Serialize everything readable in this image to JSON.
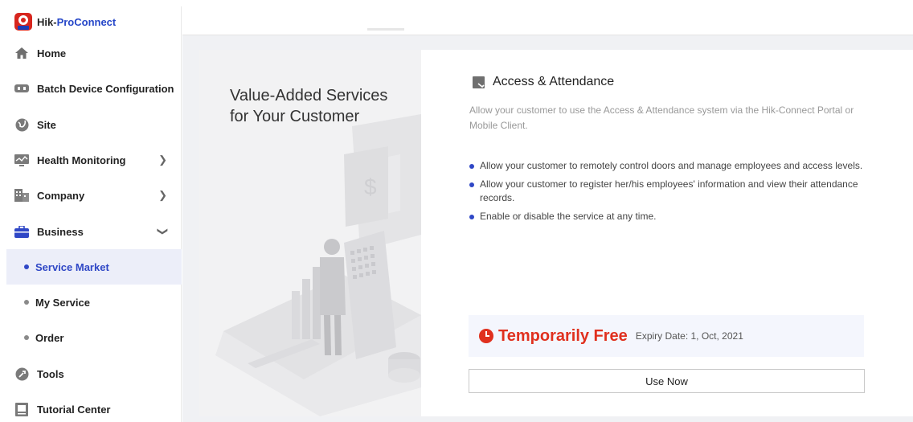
{
  "app": {
    "brand_prefix": "Hik-",
    "brand_accent": "ProConnect"
  },
  "sidebar": {
    "items": [
      {
        "label": "Home",
        "icon": "home-icon"
      },
      {
        "label": "Batch Device Configuration",
        "icon": "device-icon"
      },
      {
        "label": "Site",
        "icon": "site-icon"
      },
      {
        "label": "Health Monitoring",
        "icon": "monitor-icon",
        "chevron": ">"
      },
      {
        "label": "Company",
        "icon": "company-icon",
        "chevron": ">"
      },
      {
        "label": "Business",
        "icon": "briefcase-icon",
        "chevron": "v"
      },
      {
        "label": "Service Market",
        "sub": true,
        "active": true
      },
      {
        "label": "My Service",
        "sub": true
      },
      {
        "label": "Order",
        "sub": true
      },
      {
        "label": "Tools",
        "icon": "tools-icon"
      },
      {
        "label": "Tutorial Center",
        "icon": "tutorial-icon"
      }
    ]
  },
  "hero": {
    "title": "Value-Added Services for Your Customer"
  },
  "service": {
    "title": "Access & Attendance",
    "description": "Allow your customer to use the Access & Attendance system via the Hik-Connect Portal or Mobile Client.",
    "features": [
      "Allow your customer to remotely control doors and manage employees and access levels.",
      "Allow your customer to register her/his employees' information and view their attendance records.",
      "Enable or disable the service at any time."
    ],
    "price_label": "Temporarily Free",
    "expiry": "Expiry Date: 1, Oct, 2021",
    "cta": "Use Now"
  },
  "colors": {
    "accent": "#2f47c6",
    "free": "#e0301e",
    "brand": "#d7261e"
  }
}
